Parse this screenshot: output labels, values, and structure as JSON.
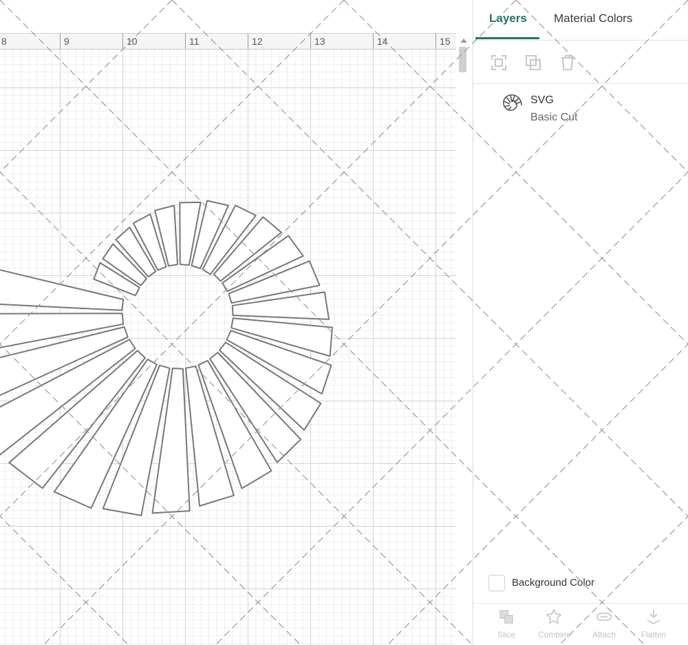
{
  "ruler": {
    "ticks": [
      "8",
      "9",
      "10",
      "11",
      "12",
      "13",
      "14",
      "15"
    ]
  },
  "panel": {
    "tabs": [
      {
        "label": "Layers",
        "active": true
      },
      {
        "label": "Material Colors",
        "active": false
      }
    ],
    "layer_tools": [
      "select-all-icon",
      "duplicate-icon",
      "delete-icon"
    ],
    "layers": [
      {
        "name": "SVG",
        "operation": "Basic Cut",
        "thumbnail": "spiral-shell-icon"
      }
    ],
    "background_color_label": "Background Color",
    "bottom_tools": [
      {
        "label": "Slice",
        "icon": "slice-icon"
      },
      {
        "label": "Combine",
        "icon": "combine-icon"
      },
      {
        "label": "Attach",
        "icon": "attach-icon"
      },
      {
        "label": "Flatten",
        "icon": "flatten-icon"
      }
    ]
  },
  "colors": {
    "accent": "#1f7a55",
    "grid_major": "#d2d2d2",
    "grid_minor": "#ececec",
    "cut_line": "#777777"
  }
}
